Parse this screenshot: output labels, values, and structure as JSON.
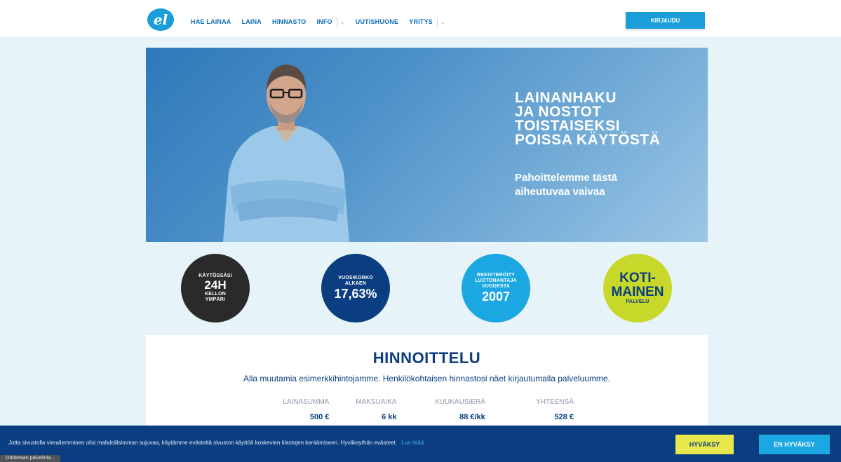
{
  "header": {
    "logo_text": "el",
    "nav": {
      "hae_lainaa": "HAE LAINAA",
      "laina": "LAINA",
      "hinnasto": "HINNASTO",
      "info": "INFO",
      "uutishuone": "UUTISHUONE",
      "yritys": "YRITYS"
    },
    "login": "KIRJAUDU"
  },
  "hero": {
    "title_lines": [
      "LAINANHAKU",
      "JA NOSTOT",
      "TOISTAISEKSI",
      "POISSA KÄYTÖSTÄ"
    ],
    "sub_lines": [
      "Pahoittelemme tästä",
      "aiheutuvaa vaivaa"
    ]
  },
  "features": {
    "c1": {
      "l1": "KÄYTÖSSÄSI",
      "big": "24H",
      "l2": "KELLON",
      "l3": "YMPÄRI"
    },
    "c2": {
      "l1": "VUOSIKORKO",
      "l2": "ALKAEN",
      "big": "17,63%"
    },
    "c3": {
      "l1": "REKISTERÖITY",
      "l2": "LUOTONANTAJA",
      "l3": "VUODESTA",
      "big": "2007"
    },
    "c4": {
      "l1": "KOTI-",
      "l2": "MAINEN",
      "l3": "PALVELU"
    }
  },
  "pricing": {
    "title": "HINNOITTELU",
    "description": "Alla muutamia esimerkkihintojamme. Henkilökohtaisen hinnastosi näet kirjautumalla palveluumme.",
    "columns": [
      "LAINASUMMA",
      "MAKSUAIKA",
      "KUUKAUSIERÄ",
      "YHTEENSÄ"
    ],
    "row": [
      "500 €",
      "6 kk",
      "88 €/kk",
      "528 €"
    ]
  },
  "cookie": {
    "text": "Jotta sivustolla vierailemminen olisi mahdollisimman sujuvaa, käytämme evästeitä sivuston käyttöä koskevien tilastojen keräämiseen. Hyväksythän evästeet.",
    "link": "Lue lisää",
    "accept": "HYVÄKSY",
    "decline": "EN HYVÄKSY"
  },
  "status_bar": "Odotetaan palvelinta..."
}
